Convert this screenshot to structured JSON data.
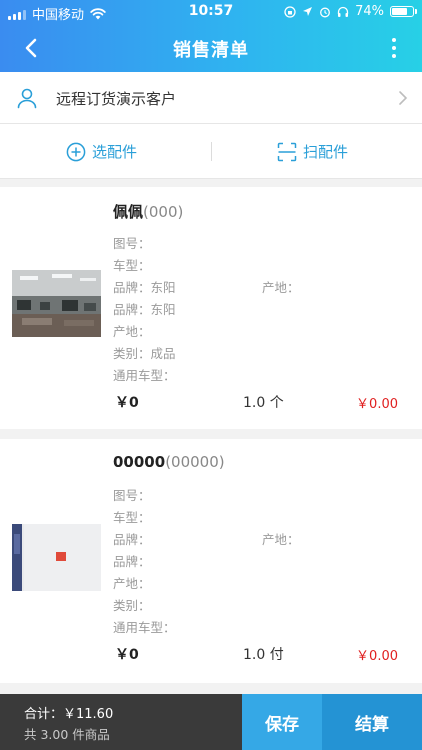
{
  "status_bar": {
    "carrier": "中国移动",
    "time": "10:57",
    "battery": "74%",
    "battery_level": 0.74
  },
  "nav": {
    "title": "销售清单"
  },
  "customer": {
    "name": "远程订货演示客户"
  },
  "actions": {
    "select_parts": "选配件",
    "scan_parts": "扫配件"
  },
  "products": [
    {
      "name": "佩佩",
      "code": "(000)",
      "part_no": "图号：",
      "vehicle_model": "车型：",
      "brand_1": "品牌：东阳",
      "origin_1": "产地：",
      "brand_2": "品牌：东阳",
      "origin_2": "产地：",
      "category": "类别：成品",
      "universal_model": "通用车型：",
      "price": "￥0",
      "qty": "1.0 个",
      "total": "￥0.00"
    },
    {
      "name": "00000",
      "code": "(00000)",
      "part_no": "图号：",
      "vehicle_model": "车型：",
      "brand_1": "品牌：",
      "origin_1": "产地：",
      "brand_2": "品牌：",
      "origin_2": "产地：",
      "category": "类别：",
      "universal_model": "通用车型：",
      "price": "￥0",
      "qty": "1.0 付",
      "total": "￥0.00"
    }
  ],
  "footer": {
    "total": "合计：￥11.60",
    "count": "共 3.00 件商品",
    "save": "保存",
    "checkout": "结算"
  },
  "colors": {
    "accent": "#2a9fd8",
    "price_red": "#e02020",
    "header_start": "#3a8cf0",
    "header_end": "#27d0e6"
  }
}
